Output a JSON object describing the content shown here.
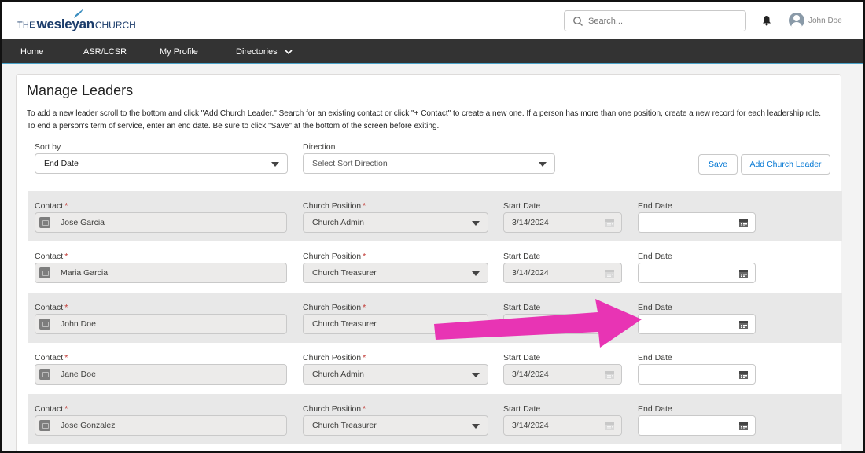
{
  "header": {
    "logo": {
      "the": "THE",
      "wesleyan": "wesleyan",
      "church": "CHURCH"
    },
    "search_placeholder": "Search...",
    "user_name": "John Doe"
  },
  "nav": {
    "items": [
      "Home",
      "ASR/LCSR",
      "My Profile",
      "Directories"
    ]
  },
  "page": {
    "title": "Manage Leaders",
    "intro": "To add a new leader scroll to the bottom and click \"Add Church Leader.\" Search for an existing contact or click \"+ Contact\" to create a new one. If a person has more than one position, create a new record for each leadership role. To end a person's term of service, enter an end date. Be sure to click \"Save\" at the bottom of the screen before exiting."
  },
  "controls": {
    "sort_by_label": "Sort by",
    "sort_by_value": "End Date",
    "direction_label": "Direction",
    "direction_value": "Select Sort Direction",
    "save_label": "Save",
    "add_leader_label": "Add Church Leader"
  },
  "columns": {
    "contact": "Contact",
    "position": "Church Position",
    "start": "Start Date",
    "end": "End Date",
    "required_mark": "*"
  },
  "leaders": [
    {
      "contact": "Jose Garcia",
      "position": "Church Admin",
      "start_date": "3/14/2024",
      "end_date": ""
    },
    {
      "contact": "Maria Garcia",
      "position": "Church Treasurer",
      "start_date": "3/14/2024",
      "end_date": ""
    },
    {
      "contact": "John Doe",
      "position": "Church Treasurer",
      "start_date": "",
      "end_date": ""
    },
    {
      "contact": "Jane Doe",
      "position": "Church Admin",
      "start_date": "3/14/2024",
      "end_date": ""
    },
    {
      "contact": "Jose Gonzalez",
      "position": "Church Treasurer",
      "start_date": "3/14/2024",
      "end_date": ""
    }
  ],
  "annotation": {
    "color": "#e834b4"
  }
}
